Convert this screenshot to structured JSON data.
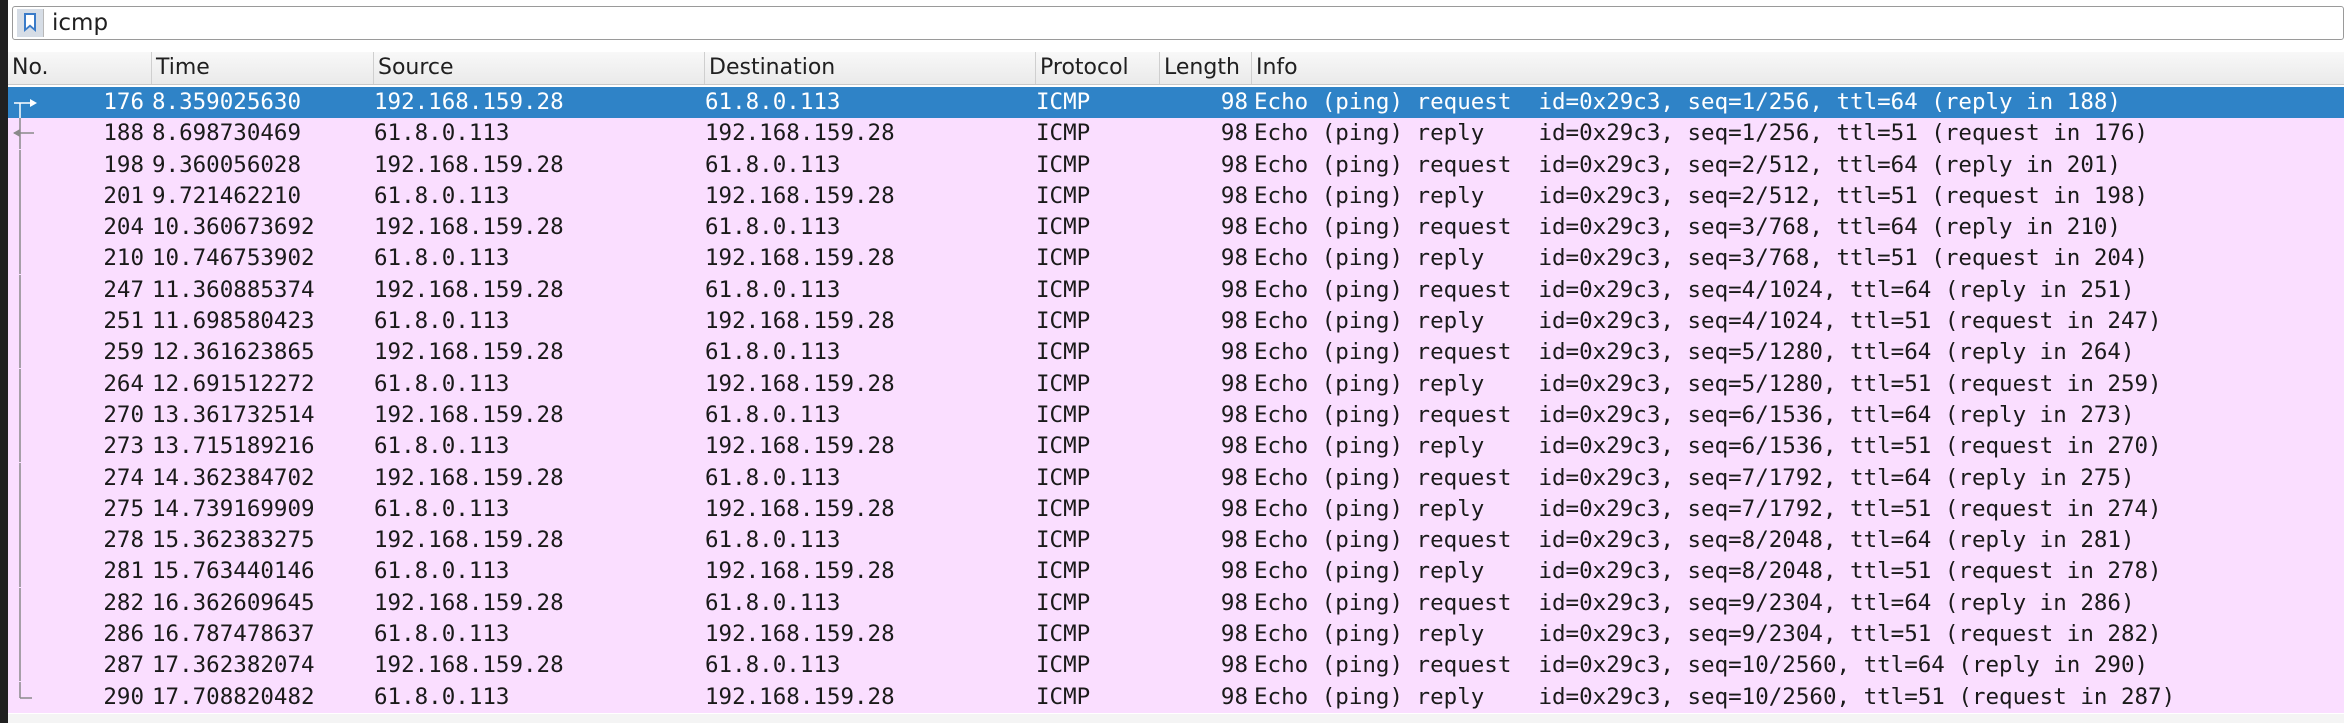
{
  "filter": {
    "value": "icmp",
    "bookmark_icon": "bookmark-icon"
  },
  "columns": {
    "no": "No.",
    "time": "Time",
    "source": "Source",
    "destination": "Destination",
    "protocol": "Protocol",
    "length": "Length",
    "info": "Info"
  },
  "colors": {
    "row_background": "#fadeff",
    "selected_background": "#2f83c7"
  },
  "selected_row_index": 0,
  "packets": [
    {
      "no": "176",
      "time": "8.359025630",
      "source": "192.168.159.28",
      "destination": "61.8.0.113",
      "protocol": "ICMP",
      "length": "98",
      "info": "Echo (ping) request  id=0x29c3, seq=1/256, ttl=64 (reply in 188)",
      "rel": "first"
    },
    {
      "no": "188",
      "time": "8.698730469",
      "source": "61.8.0.113",
      "destination": "192.168.159.28",
      "protocol": "ICMP",
      "length": "98",
      "info": "Echo (ping) reply    id=0x29c3, seq=1/256, ttl=51 (request in 176)",
      "rel": "reply"
    },
    {
      "no": "198",
      "time": "9.360056028",
      "source": "192.168.159.28",
      "destination": "61.8.0.113",
      "protocol": "ICMP",
      "length": "98",
      "info": "Echo (ping) request  id=0x29c3, seq=2/512, ttl=64 (reply in 201)",
      "rel": "line"
    },
    {
      "no": "201",
      "time": "9.721462210",
      "source": "61.8.0.113",
      "destination": "192.168.159.28",
      "protocol": "ICMP",
      "length": "98",
      "info": "Echo (ping) reply    id=0x29c3, seq=2/512, ttl=51 (request in 198)",
      "rel": "line"
    },
    {
      "no": "204",
      "time": "10.360673692",
      "source": "192.168.159.28",
      "destination": "61.8.0.113",
      "protocol": "ICMP",
      "length": "98",
      "info": "Echo (ping) request  id=0x29c3, seq=3/768, ttl=64 (reply in 210)",
      "rel": "line"
    },
    {
      "no": "210",
      "time": "10.746753902",
      "source": "61.8.0.113",
      "destination": "192.168.159.28",
      "protocol": "ICMP",
      "length": "98",
      "info": "Echo (ping) reply    id=0x29c3, seq=3/768, ttl=51 (request in 204)",
      "rel": "line"
    },
    {
      "no": "247",
      "time": "11.360885374",
      "source": "192.168.159.28",
      "destination": "61.8.0.113",
      "protocol": "ICMP",
      "length": "98",
      "info": "Echo (ping) request  id=0x29c3, seq=4/1024, ttl=64 (reply in 251)",
      "rel": "line"
    },
    {
      "no": "251",
      "time": "11.698580423",
      "source": "61.8.0.113",
      "destination": "192.168.159.28",
      "protocol": "ICMP",
      "length": "98",
      "info": "Echo (ping) reply    id=0x29c3, seq=4/1024, ttl=51 (request in 247)",
      "rel": "line"
    },
    {
      "no": "259",
      "time": "12.361623865",
      "source": "192.168.159.28",
      "destination": "61.8.0.113",
      "protocol": "ICMP",
      "length": "98",
      "info": "Echo (ping) request  id=0x29c3, seq=5/1280, ttl=64 (reply in 264)",
      "rel": "line"
    },
    {
      "no": "264",
      "time": "12.691512272",
      "source": "61.8.0.113",
      "destination": "192.168.159.28",
      "protocol": "ICMP",
      "length": "98",
      "info": "Echo (ping) reply    id=0x29c3, seq=5/1280, ttl=51 (request in 259)",
      "rel": "line"
    },
    {
      "no": "270",
      "time": "13.361732514",
      "source": "192.168.159.28",
      "destination": "61.8.0.113",
      "protocol": "ICMP",
      "length": "98",
      "info": "Echo (ping) request  id=0x29c3, seq=6/1536, ttl=64 (reply in 273)",
      "rel": "line"
    },
    {
      "no": "273",
      "time": "13.715189216",
      "source": "61.8.0.113",
      "destination": "192.168.159.28",
      "protocol": "ICMP",
      "length": "98",
      "info": "Echo (ping) reply    id=0x29c3, seq=6/1536, ttl=51 (request in 270)",
      "rel": "line"
    },
    {
      "no": "274",
      "time": "14.362384702",
      "source": "192.168.159.28",
      "destination": "61.8.0.113",
      "protocol": "ICMP",
      "length": "98",
      "info": "Echo (ping) request  id=0x29c3, seq=7/1792, ttl=64 (reply in 275)",
      "rel": "line"
    },
    {
      "no": "275",
      "time": "14.739169909",
      "source": "61.8.0.113",
      "destination": "192.168.159.28",
      "protocol": "ICMP",
      "length": "98",
      "info": "Echo (ping) reply    id=0x29c3, seq=7/1792, ttl=51 (request in 274)",
      "rel": "line"
    },
    {
      "no": "278",
      "time": "15.362383275",
      "source": "192.168.159.28",
      "destination": "61.8.0.113",
      "protocol": "ICMP",
      "length": "98",
      "info": "Echo (ping) request  id=0x29c3, seq=8/2048, ttl=64 (reply in 281)",
      "rel": "line"
    },
    {
      "no": "281",
      "time": "15.763440146",
      "source": "61.8.0.113",
      "destination": "192.168.159.28",
      "protocol": "ICMP",
      "length": "98",
      "info": "Echo (ping) reply    id=0x29c3, seq=8/2048, ttl=51 (request in 278)",
      "rel": "line"
    },
    {
      "no": "282",
      "time": "16.362609645",
      "source": "192.168.159.28",
      "destination": "61.8.0.113",
      "protocol": "ICMP",
      "length": "98",
      "info": "Echo (ping) request  id=0x29c3, seq=9/2304, ttl=64 (reply in 286)",
      "rel": "line"
    },
    {
      "no": "286",
      "time": "16.787478637",
      "source": "61.8.0.113",
      "destination": "192.168.159.28",
      "protocol": "ICMP",
      "length": "98",
      "info": "Echo (ping) reply    id=0x29c3, seq=9/2304, ttl=51 (request in 282)",
      "rel": "line"
    },
    {
      "no": "287",
      "time": "17.362382074",
      "source": "192.168.159.28",
      "destination": "61.8.0.113",
      "protocol": "ICMP",
      "length": "98",
      "info": "Echo (ping) request  id=0x29c3, seq=10/2560, ttl=64 (reply in 290)",
      "rel": "line"
    },
    {
      "no": "290",
      "time": "17.708820482",
      "source": "61.8.0.113",
      "destination": "192.168.159.28",
      "protocol": "ICMP",
      "length": "98",
      "info": "Echo (ping) reply    id=0x29c3, seq=10/2560, ttl=51 (request in 287)",
      "rel": "last"
    }
  ]
}
